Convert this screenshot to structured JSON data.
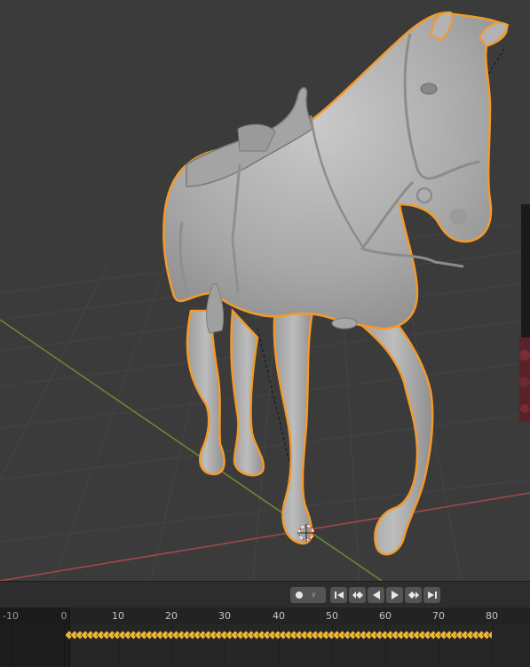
{
  "timeline": {
    "ruler_labels": [
      "-10",
      "0",
      "10",
      "20",
      "30",
      "40",
      "50",
      "60",
      "70",
      "80"
    ],
    "keyframe_range": [
      0,
      79
    ],
    "keyframe_color": "#f2b632",
    "buttons": [
      {
        "name": "jump-to-start-button",
        "icon": "jump-start-icon"
      },
      {
        "name": "jump-to-previous-keyframe-button",
        "icon": "prev-keyframe-icon"
      },
      {
        "name": "play-reverse-button",
        "icon": "play-reverse-icon"
      },
      {
        "name": "play-button",
        "icon": "play-icon"
      },
      {
        "name": "jump-to-next-keyframe-button",
        "icon": "next-keyframe-icon"
      },
      {
        "name": "jump-to-end-button",
        "icon": "jump-end-icon"
      }
    ]
  },
  "viewport": {
    "selection_outline_color": "#f39a2b",
    "grid_x_axis_color": "#a8474f",
    "grid_y_axis_color": "#6b8c2f"
  }
}
